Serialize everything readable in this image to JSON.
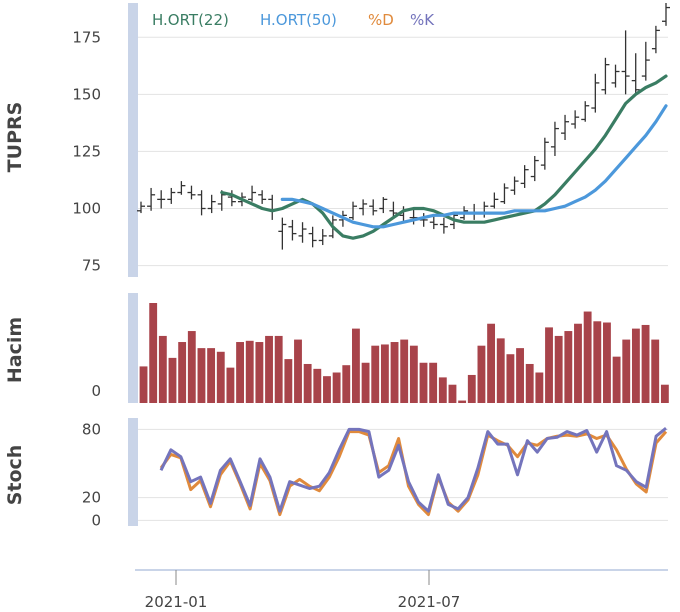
{
  "chart_data": [
    {
      "panel": "price",
      "type": "line",
      "ylabel": "TUPRS",
      "ylim": [
        70,
        190
      ],
      "yticks": [
        "75",
        "100",
        "125",
        "150",
        "175"
      ],
      "x": [
        "2020-12",
        "2020-12",
        "2020-12",
        "2020-12",
        "2020-12",
        "2021-01",
        "2021-01",
        "2021-01",
        "2021-01",
        "2021-01",
        "2021-02",
        "2021-02",
        "2021-02",
        "2021-02",
        "2021-03",
        "2021-03",
        "2021-03",
        "2021-03",
        "2021-04",
        "2021-04",
        "2021-04",
        "2021-04",
        "2021-05",
        "2021-05",
        "2021-05",
        "2021-05",
        "2021-06",
        "2021-06",
        "2021-06",
        "2021-06",
        "2021-07",
        "2021-07",
        "2021-07",
        "2021-07",
        "2021-08",
        "2021-08",
        "2021-08",
        "2021-08",
        "2021-09",
        "2021-09",
        "2021-09",
        "2021-09",
        "2021-10",
        "2021-10",
        "2021-10",
        "2021-10",
        "2021-11",
        "2021-11",
        "2021-11",
        "2021-11",
        "2021-12",
        "2021-12",
        "2021-12"
      ],
      "series": [
        {
          "name": "H.ORT(22)",
          "color": "#3a7d63",
          "values": [
            null,
            null,
            null,
            null,
            null,
            null,
            null,
            null,
            107,
            106,
            104,
            102,
            100,
            99,
            100,
            102,
            104,
            102,
            98,
            92,
            88,
            87,
            88,
            90,
            93,
            96,
            99,
            100,
            100,
            99,
            97,
            95,
            94,
            94,
            94,
            95,
            96,
            97,
            98,
            99,
            102,
            106,
            111,
            116,
            121,
            126,
            132,
            139,
            146,
            150,
            153,
            155,
            158
          ]
        },
        {
          "name": "H.ORT(50)",
          "color": "#4c98db",
          "values": [
            null,
            null,
            null,
            null,
            null,
            null,
            null,
            null,
            null,
            null,
            null,
            null,
            null,
            null,
            104,
            104,
            103,
            102,
            100,
            98,
            96,
            94,
            93,
            92,
            92,
            93,
            94,
            95,
            96,
            97,
            97,
            98,
            98,
            98,
            98,
            98,
            98,
            99,
            99,
            99,
            99,
            100,
            101,
            103,
            105,
            108,
            112,
            117,
            122,
            127,
            132,
            138,
            145
          ]
        },
        {
          "name": "%D",
          "color": "#e08a3c",
          "values": []
        },
        {
          "name": "%K",
          "color": "#7474bc",
          "values": []
        }
      ],
      "candles": [
        [
          99,
          103,
          98,
          101
        ],
        [
          101,
          109,
          99,
          106
        ],
        [
          104,
          108,
          100,
          104
        ],
        [
          104,
          109,
          102,
          107
        ],
        [
          107,
          112,
          106,
          110
        ],
        [
          107,
          110,
          104,
          106
        ],
        [
          106,
          108,
          97,
          100
        ],
        [
          100,
          106,
          98,
          103
        ],
        [
          102,
          108,
          99,
          106
        ],
        [
          105,
          108,
          101,
          103
        ],
        [
          103,
          107,
          101,
          105
        ],
        [
          104,
          110,
          103,
          107
        ],
        [
          106,
          108,
          102,
          104
        ],
        [
          104,
          106,
          95,
          99
        ],
        [
          90,
          96,
          82,
          93
        ],
        [
          92,
          95,
          86,
          89
        ],
        [
          88,
          94,
          85,
          91
        ],
        [
          89,
          92,
          83,
          86
        ],
        [
          86,
          91,
          84,
          88
        ],
        [
          88,
          97,
          87,
          95
        ],
        [
          95,
          99,
          92,
          97
        ],
        [
          96,
          103,
          95,
          101
        ],
        [
          100,
          104,
          97,
          102
        ],
        [
          101,
          104,
          97,
          99
        ],
        [
          100,
          105,
          98,
          104
        ],
        [
          99,
          103,
          96,
          98
        ],
        [
          97,
          101,
          94,
          99
        ],
        [
          96,
          100,
          93,
          96
        ],
        [
          95,
          98,
          92,
          95
        ],
        [
          94,
          97,
          91,
          93
        ],
        [
          93,
          96,
          89,
          92
        ],
        [
          93,
          98,
          91,
          97
        ],
        [
          96,
          101,
          95,
          99
        ],
        [
          98,
          102,
          95,
          98
        ],
        [
          98,
          103,
          96,
          101
        ],
        [
          101,
          107,
          100,
          104
        ],
        [
          103,
          111,
          102,
          109
        ],
        [
          108,
          114,
          106,
          112
        ],
        [
          111,
          119,
          109,
          117
        ],
        [
          114,
          123,
          112,
          121
        ],
        [
          119,
          131,
          117,
          129
        ],
        [
          127,
          138,
          123,
          135
        ],
        [
          133,
          141,
          130,
          138
        ],
        [
          137,
          143,
          135,
          140
        ],
        [
          139,
          147,
          138,
          145
        ],
        [
          144,
          159,
          142,
          155
        ],
        [
          152,
          166,
          150,
          163
        ],
        [
          155,
          163,
          153,
          160
        ],
        [
          160,
          178,
          150,
          158
        ],
        [
          156,
          168,
          150,
          152
        ],
        [
          158,
          173,
          156,
          165
        ],
        [
          170,
          180,
          168,
          178
        ],
        [
          182,
          190,
          180,
          188
        ]
      ]
    },
    {
      "panel": "volume",
      "type": "bar",
      "ylabel": "Hacim",
      "yticks": [
        "0"
      ],
      "values": [
        30,
        82,
        55,
        37,
        50,
        59,
        45,
        45,
        42,
        29,
        50,
        51,
        50,
        55,
        55,
        36,
        52,
        32,
        28,
        22,
        25,
        31,
        61,
        33,
        47,
        48,
        50,
        52,
        47,
        33,
        33,
        21,
        15,
        2,
        23,
        47,
        65,
        53,
        40,
        45,
        32,
        25,
        62,
        55,
        59,
        65,
        75,
        67,
        66,
        38,
        52,
        61,
        64,
        52,
        15
      ],
      "color": "#a8434a"
    },
    {
      "panel": "stoch",
      "type": "line",
      "ylabel": "Stoch",
      "ylim": [
        -5,
        90
      ],
      "yticks": [
        "0",
        "20",
        "80"
      ],
      "series": [
        {
          "name": "%D",
          "color": "#e08a3c",
          "values": [
            46,
            58,
            55,
            27,
            35,
            12,
            40,
            52,
            32,
            10,
            50,
            35,
            5,
            30,
            36,
            30,
            26,
            38,
            56,
            78,
            78,
            75,
            42,
            48,
            72,
            30,
            14,
            5,
            38,
            16,
            8,
            18,
            40,
            75,
            70,
            66,
            56,
            68,
            66,
            72,
            74,
            75,
            74,
            76,
            72,
            75,
            62,
            45,
            32,
            25,
            68,
            78
          ]
        },
        {
          "name": "%K",
          "color": "#7474bc",
          "values": [
            44,
            62,
            56,
            34,
            38,
            15,
            44,
            54,
            34,
            13,
            54,
            38,
            8,
            34,
            31,
            28,
            30,
            42,
            62,
            80,
            80,
            78,
            38,
            44,
            66,
            34,
            16,
            8,
            40,
            14,
            10,
            20,
            46,
            78,
            67,
            67,
            40,
            70,
            60,
            72,
            73,
            78,
            75,
            79,
            60,
            78,
            48,
            44,
            34,
            29,
            74,
            81
          ]
        }
      ]
    }
  ],
  "x_axis": {
    "ticks": [
      "2021-01",
      "2021-07"
    ]
  },
  "legend": [
    {
      "name": "H.ORT(22)",
      "color": "#3a7d63"
    },
    {
      "name": "H.ORT(50)",
      "color": "#4c98db"
    },
    {
      "name": "%D",
      "color": "#e08a3c"
    },
    {
      "name": "%K",
      "color": "#7474bc"
    }
  ]
}
